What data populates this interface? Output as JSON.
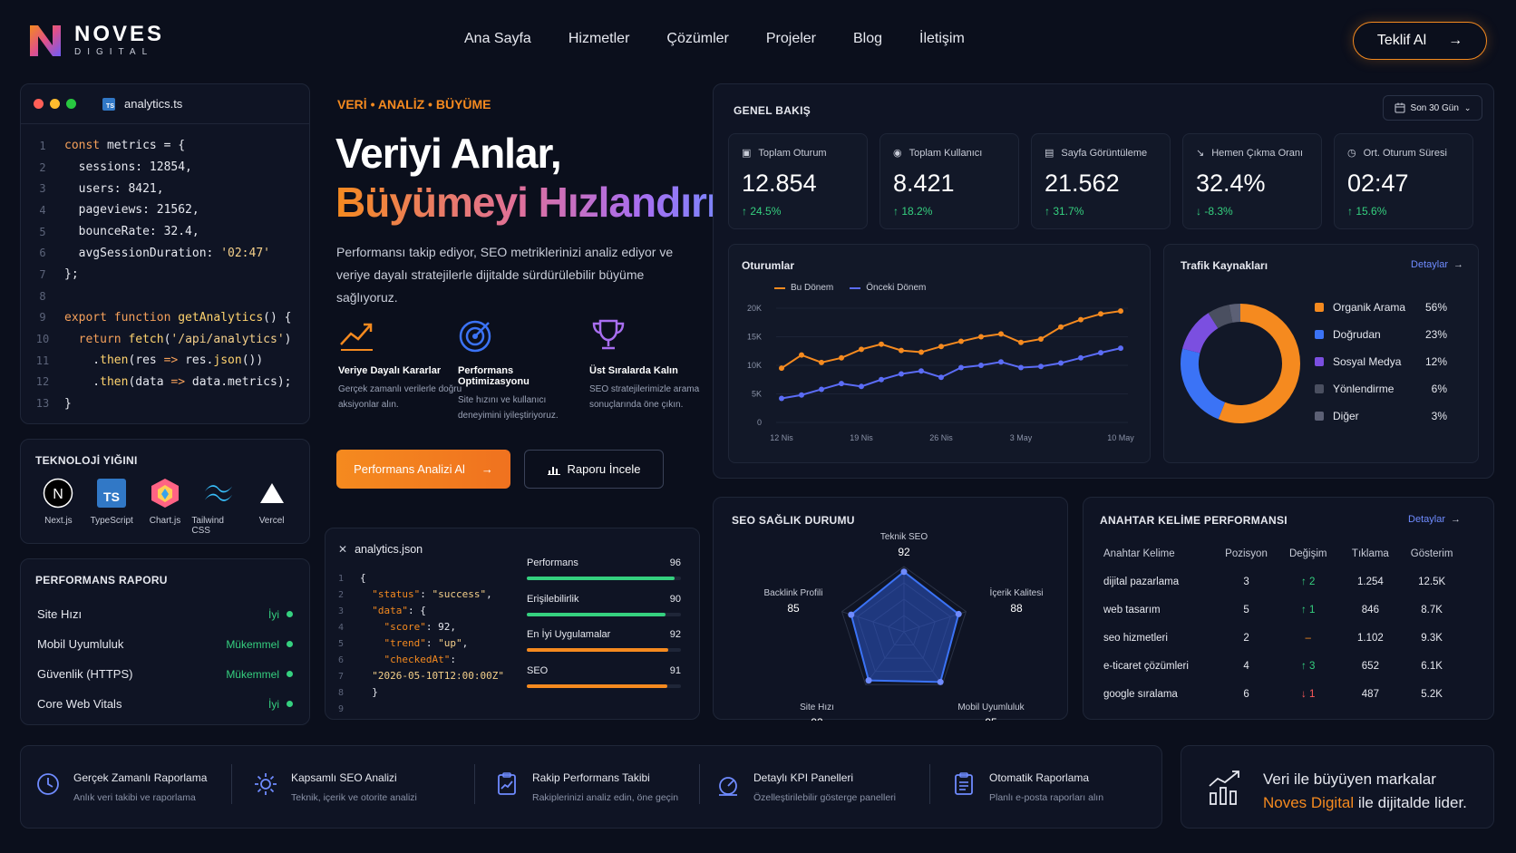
{
  "brand": {
    "name": "NOVES",
    "sub": "DIGITAL"
  },
  "nav": [
    "Ana Sayfa",
    "Hizmetler",
    "Çözümler",
    "Projeler",
    "Blog",
    "İletişim"
  ],
  "cta": {
    "label": "Teklif Al"
  },
  "code_panel": {
    "filename": "analytics.ts",
    "line_numbers": [
      "1",
      "2",
      "3",
      "4",
      "5",
      "6",
      "7",
      "8",
      "9",
      "10",
      "11",
      "12",
      "13"
    ]
  },
  "tech": {
    "title": "TEKNOLOJİ YIĞINI",
    "items": [
      "Next.js",
      "TypeScript",
      "Chart.js",
      "Tailwind CSS",
      "Vercel"
    ]
  },
  "perf_report": {
    "title": "PERFORMANS RAPORU",
    "rows": [
      {
        "label": "Site Hızı",
        "value": "İyi"
      },
      {
        "label": "Mobil Uyumluluk",
        "value": "Mükemmel"
      },
      {
        "label": "Güvenlik (HTTPS)",
        "value": "Mükemmel"
      },
      {
        "label": "Core Web Vitals",
        "value": "İyi"
      }
    ]
  },
  "hero": {
    "eyebrow": "VERİ • ANALİZ • BÜYÜME",
    "title_1": "Veriyi Anlar,",
    "title_2": "Büyümeyi Hızlandırır.",
    "lead": "Performansı takip ediyor, SEO metriklerinizi analiz ediyor ve veriye dayalı stratejilerle dijitalde sürdürülebilir büyüme sağlıyoruz.",
    "features": [
      {
        "title": "Veriye Dayalı Kararlar",
        "desc": "Gerçek zamanlı verilerle doğru aksiyonlar alın."
      },
      {
        "title": "Performans Optimizasyonu",
        "desc": "Site hızını ve kullanıcı deneyimini iyileştiriyoruz."
      },
      {
        "title": "Üst Sıralarda Kalın",
        "desc": "SEO stratejilerimizle arama sonuçlarında öne çıkın."
      }
    ],
    "btn_primary": "Performans Analizi Al",
    "btn_secondary": "Raporu İncele"
  },
  "json_panel": {
    "filename": "analytics.json",
    "line_numbers": [
      "1",
      "2",
      "3",
      "4",
      "5",
      "6",
      "7",
      "8",
      "9"
    ],
    "bars": [
      {
        "label": "Performans",
        "value": 96,
        "color": "#35d07f"
      },
      {
        "label": "Erişilebilirlik",
        "value": 90,
        "color": "#35d07f"
      },
      {
        "label": "En İyi Uygulamalar",
        "value": 92,
        "color": "#f58a1f"
      },
      {
        "label": "SEO",
        "value": 91,
        "color": "#f58a1f"
      }
    ]
  },
  "overview": {
    "title": "GENEL BAKIŞ",
    "range": "Son 30 Gün",
    "kpis": [
      {
        "label": "Toplam Oturum",
        "value": "12.854",
        "delta": "↑ 24.5%",
        "trend": "up"
      },
      {
        "label": "Toplam Kullanıcı",
        "value": "8.421",
        "delta": "↑ 18.2%",
        "trend": "up"
      },
      {
        "label": "Sayfa Görüntüleme",
        "value": "21.562",
        "delta": "↑ 31.7%",
        "trend": "up"
      },
      {
        "label": "Hemen Çıkma Oranı",
        "value": "32.4%",
        "delta": "↓ -8.3%",
        "trend": "up"
      },
      {
        "label": "Ort. Oturum Süresi",
        "value": "02:47",
        "delta": "↑ 15.6%",
        "trend": "up"
      }
    ]
  },
  "chart_data": [
    {
      "type": "line",
      "title": "Oturumlar",
      "x": [
        "12 Nis",
        "13 Nis",
        "15 Nis",
        "17 Nis",
        "19 Nis",
        "21 Nis",
        "23 Nis",
        "24 Nis",
        "26 Nis",
        "28 Nis",
        "30 Nis",
        "2 May",
        "3 May",
        "5 May",
        "7 May",
        "8 May",
        "9 May",
        "10 May"
      ],
      "xticks": [
        "12 Nis",
        "19 Nis",
        "26 Nis",
        "3 May",
        "10 May"
      ],
      "yticks": [
        "0",
        "5K",
        "10K",
        "15K",
        "20K"
      ],
      "ylim": [
        0,
        20000
      ],
      "series": [
        {
          "name": "Bu Dönem",
          "color": "#f58a1f",
          "values": [
            9500,
            11800,
            10500,
            11300,
            12800,
            13700,
            12600,
            12300,
            13300,
            14200,
            15000,
            15500,
            14000,
            14600,
            16700,
            18000,
            19000,
            19500
          ]
        },
        {
          "name": "Önceki Dönem",
          "color": "#5b6cf6",
          "values": [
            4200,
            4800,
            5800,
            6800,
            6300,
            7500,
            8500,
            9000,
            7900,
            9600,
            10000,
            10600,
            9600,
            9800,
            10400,
            11300,
            12200,
            13000
          ]
        }
      ],
      "grid": true,
      "legend": "top-left"
    },
    {
      "type": "pie",
      "title": "Trafik Kaynakları",
      "categories": [
        "Organik Arama",
        "Doğrudan",
        "Sosyal Medya",
        "Yönlendirme",
        "Diğer"
      ],
      "values": [
        56,
        23,
        12,
        6,
        3
      ],
      "colors": [
        "#f58a1f",
        "#3b73f6",
        "#7b4fe0",
        "#4a4f60",
        "#5c6075"
      ],
      "legend": "right"
    },
    {
      "type": "radar",
      "title": "SEO SAĞLIK DURUMU",
      "categories": [
        "Teknik SEO",
        "İçerik Kalitesi",
        "Mobil Uyumluluk",
        "Site Hızı",
        "Backlink Profili"
      ],
      "values": [
        92,
        88,
        95,
        92,
        85
      ],
      "max": 100
    }
  ],
  "traffic_link": "Detaylar",
  "keywords": {
    "title": "ANAHTAR KELİME PERFORMANSI",
    "link": "Detaylar",
    "headers": [
      "Anahtar Kelime",
      "Pozisyon",
      "Değişim",
      "Tıklama",
      "Gösterim"
    ],
    "rows": [
      [
        "dijital pazarlama",
        "3",
        "↑ 2",
        "1.254",
        "12.5K"
      ],
      [
        "web tasarım",
        "5",
        "↑ 1",
        "846",
        "8.7K"
      ],
      [
        "seo hizmetleri",
        "2",
        "–",
        "1.102",
        "9.3K"
      ],
      [
        "e-ticaret çözümleri",
        "4",
        "↑ 3",
        "652",
        "6.1K"
      ],
      [
        "google sıralama",
        "6",
        "↓ 1",
        "487",
        "5.2K"
      ]
    ]
  },
  "bottom": {
    "items": [
      {
        "title": "Gerçek Zamanlı Raporlama",
        "desc": "Anlık veri takibi ve raporlama"
      },
      {
        "title": "Kapsamlı SEO Analizi",
        "desc": "Teknik, içerik ve otorite analizi"
      },
      {
        "title": "Rakip Performans Takibi",
        "desc": "Rakiplerinizi analiz edin, öne geçin"
      },
      {
        "title": "Detaylı KPI Panelleri",
        "desc": "Özelleştirilebilir gösterge panelleri"
      },
      {
        "title": "Otomatik Raporlama",
        "desc": "Planlı e-posta raporları alın"
      }
    ],
    "promo_line1": "Veri ile büyüyen markalar",
    "promo_brand": "Noves Digital",
    "promo_line2": " ile dijitalde lider."
  }
}
